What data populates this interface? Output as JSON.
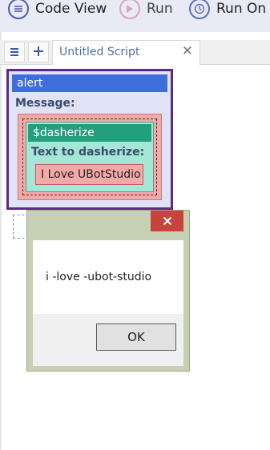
{
  "toolbar": {
    "code_view_label": "Code View",
    "run_label": "Run",
    "run_on_label": "Run On"
  },
  "tabs": {
    "menu_icon": "hamburger-icon",
    "add_icon": "plus-icon",
    "active_tab_title": "Untitled Script",
    "close_symbol": "✕"
  },
  "script": {
    "alert": {
      "command": "alert",
      "message_label": "Message:",
      "color": "#3e6ddc"
    },
    "dasherize": {
      "command": "$dasherize",
      "text_label": "Text to dasherize:",
      "text_value": "I Love UBotStudio",
      "color": "#22a07c"
    }
  },
  "dialog": {
    "close_symbol": "✕",
    "message": "i -love -ubot-studio",
    "ok_label": "OK"
  },
  "colors": {
    "accent": "#3e6ddc",
    "block_border": "#5b2a86",
    "close_red": "#c9433d"
  }
}
